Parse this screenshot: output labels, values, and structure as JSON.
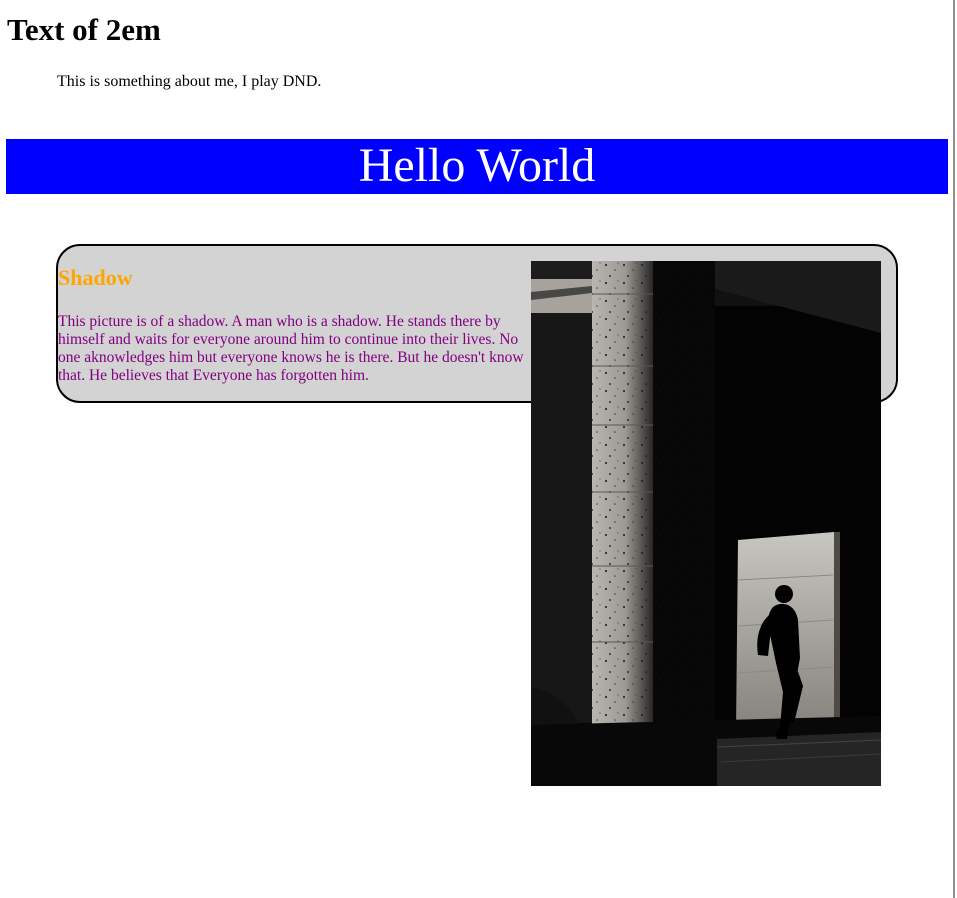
{
  "page": {
    "heading": "Text of 2em",
    "intro": "This is something about me, I play DND."
  },
  "banner": {
    "title": "Hello World",
    "background_color": "#0000ff",
    "text_color": "#ffffff"
  },
  "card": {
    "heading": "Shadow",
    "heading_color": "#ffa500",
    "text": "This picture is of a shadow. A man who is a shadow. He stands there by himself and waits for everyone around him to continue into their lives. No one aknowledges him but everyone knows he is there. But he doesn't know that. He believes that Everyone has forgotten him.",
    "text_color": "#800080",
    "background_color": "#d3d3d3",
    "image": {
      "subject": "silhouette-of-man-walking-under-stone-arcade"
    }
  }
}
